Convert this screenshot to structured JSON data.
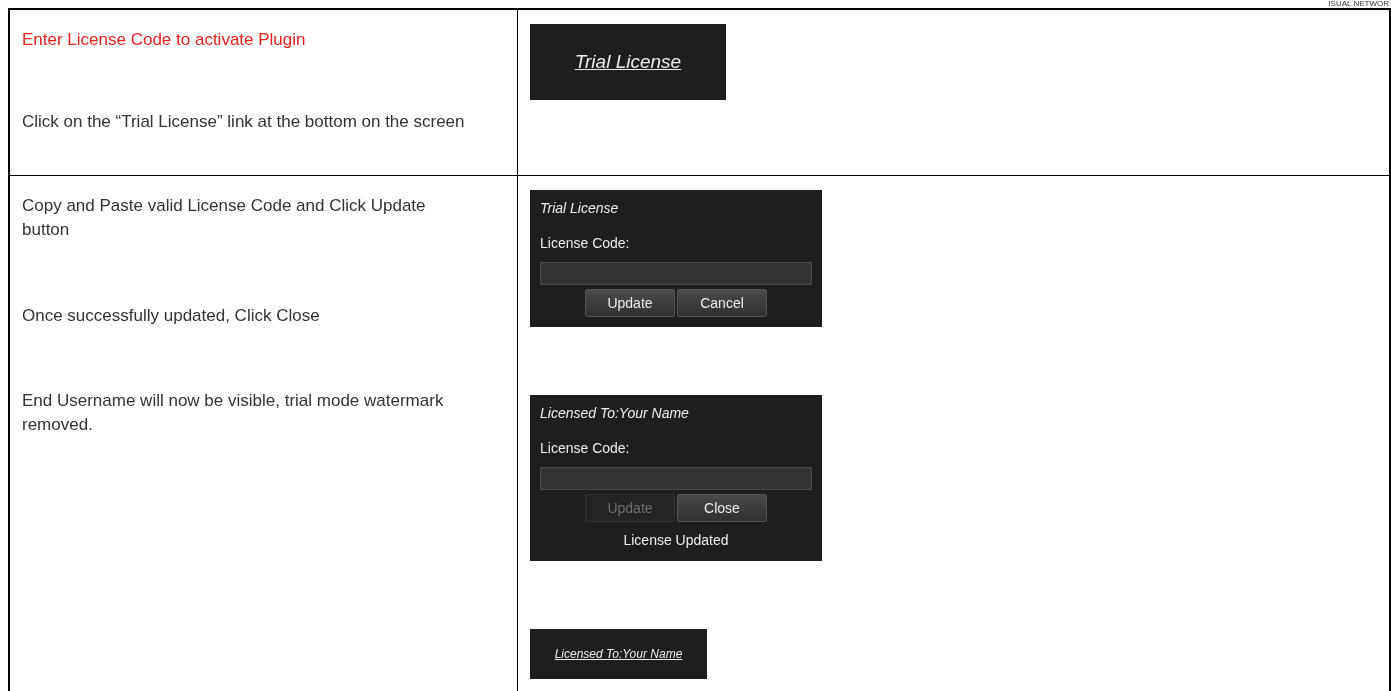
{
  "header_text": "ISUAL NETWOR",
  "rows": [
    {
      "left": [
        {
          "kind": "heading",
          "text": "Enter License Code to activate Plugin"
        },
        {
          "kind": "step",
          "text": "Click on the “Trial License” link at the bottom on the screen"
        }
      ],
      "right": [
        {
          "kind": "link_panel",
          "link": "Trial License"
        }
      ]
    },
    {
      "left": [
        {
          "kind": "step",
          "text": "Copy and Paste valid License Code and Click Update button"
        },
        {
          "kind": "step",
          "text": "Once successfully updated, Click Close"
        },
        {
          "kind": "step",
          "text": "End Username will now be visible, trial mode watermark removed."
        }
      ],
      "right": [
        {
          "kind": "dialog",
          "title": "Trial License",
          "label": "License Code:",
          "buttons": [
            {
              "label": "Update",
              "disabled": false
            },
            {
              "label": "Cancel",
              "disabled": false
            }
          ]
        },
        {
          "kind": "dialog",
          "title": "Licensed To:Your Name",
          "label": "License Code:",
          "buttons": [
            {
              "label": "Update",
              "disabled": true
            },
            {
              "label": "Close",
              "disabled": false
            }
          ],
          "status": "License Updated"
        },
        {
          "kind": "link_panel",
          "link": "Licensed To:Your Name"
        }
      ]
    }
  ]
}
